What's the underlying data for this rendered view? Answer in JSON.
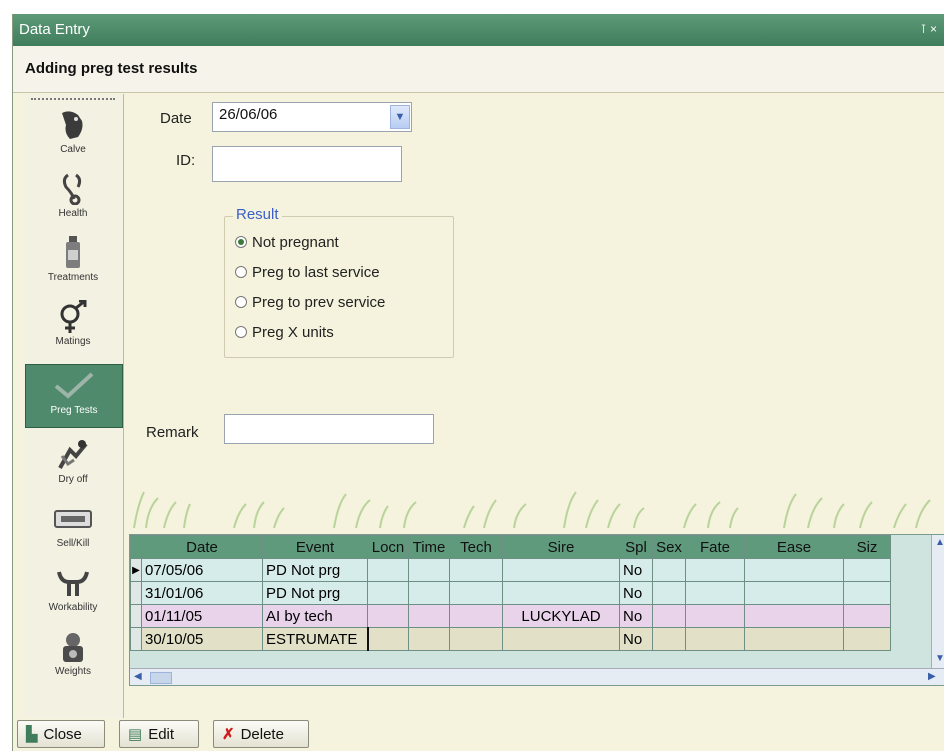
{
  "window": {
    "title": "Data Entry",
    "pin_glyph": "⊺ ×"
  },
  "header": {
    "title": "Adding preg test results"
  },
  "sidebar": {
    "items": [
      {
        "label": "Calve",
        "icon": "calf-icon"
      },
      {
        "label": "Health",
        "icon": "stethoscope-icon"
      },
      {
        "label": "Treatments",
        "icon": "bottle-icon"
      },
      {
        "label": "Matings",
        "icon": "male-female-icon"
      },
      {
        "label": "Preg Tests",
        "icon": "checkmark-icon",
        "active": true
      },
      {
        "label": "Dry off",
        "icon": "dry-off-icon"
      },
      {
        "label": "Sell/Kill",
        "icon": "ear-tag-icon"
      },
      {
        "label": "Workability",
        "icon": "horns-icon"
      },
      {
        "label": "Weights",
        "icon": "scale-icon"
      }
    ]
  },
  "form": {
    "date_label": "Date",
    "date_value": "26/06/06",
    "id_label": "ID:",
    "id_value": "",
    "result_legend": "Result",
    "result_options": [
      "Not pregnant",
      "Preg to last service",
      "Preg to prev service",
      "Preg X units"
    ],
    "result_selected": 0,
    "remark_label": "Remark",
    "remark_value": ""
  },
  "grid": {
    "columns": [
      "Date",
      "Event",
      "Locn",
      "Time",
      "Tech",
      "Sire",
      "Spl",
      "Sex",
      "Fate",
      "Ease",
      "Siz"
    ],
    "rows": [
      [
        "07/05/06",
        "PD Not prg",
        "",
        "",
        "",
        "",
        "No",
        "",
        "",
        "",
        ""
      ],
      [
        "31/01/06",
        "PD Not prg",
        "",
        "",
        "",
        "",
        "No",
        "",
        "",
        "",
        ""
      ],
      [
        "01/11/05",
        "AI by tech",
        "",
        "",
        "",
        "LUCKYLAD",
        "No",
        "",
        "",
        "",
        ""
      ],
      [
        "30/10/05",
        "ESTRUMATE",
        "",
        "",
        "",
        "",
        "No",
        "",
        "",
        "",
        ""
      ]
    ],
    "current_row": 0
  },
  "footer": {
    "close_label": "Close",
    "edit_label": "Edit",
    "delete_label": "Delete"
  },
  "colors": {
    "accent": "#4f8a6c",
    "background": "#f5f2dd"
  }
}
